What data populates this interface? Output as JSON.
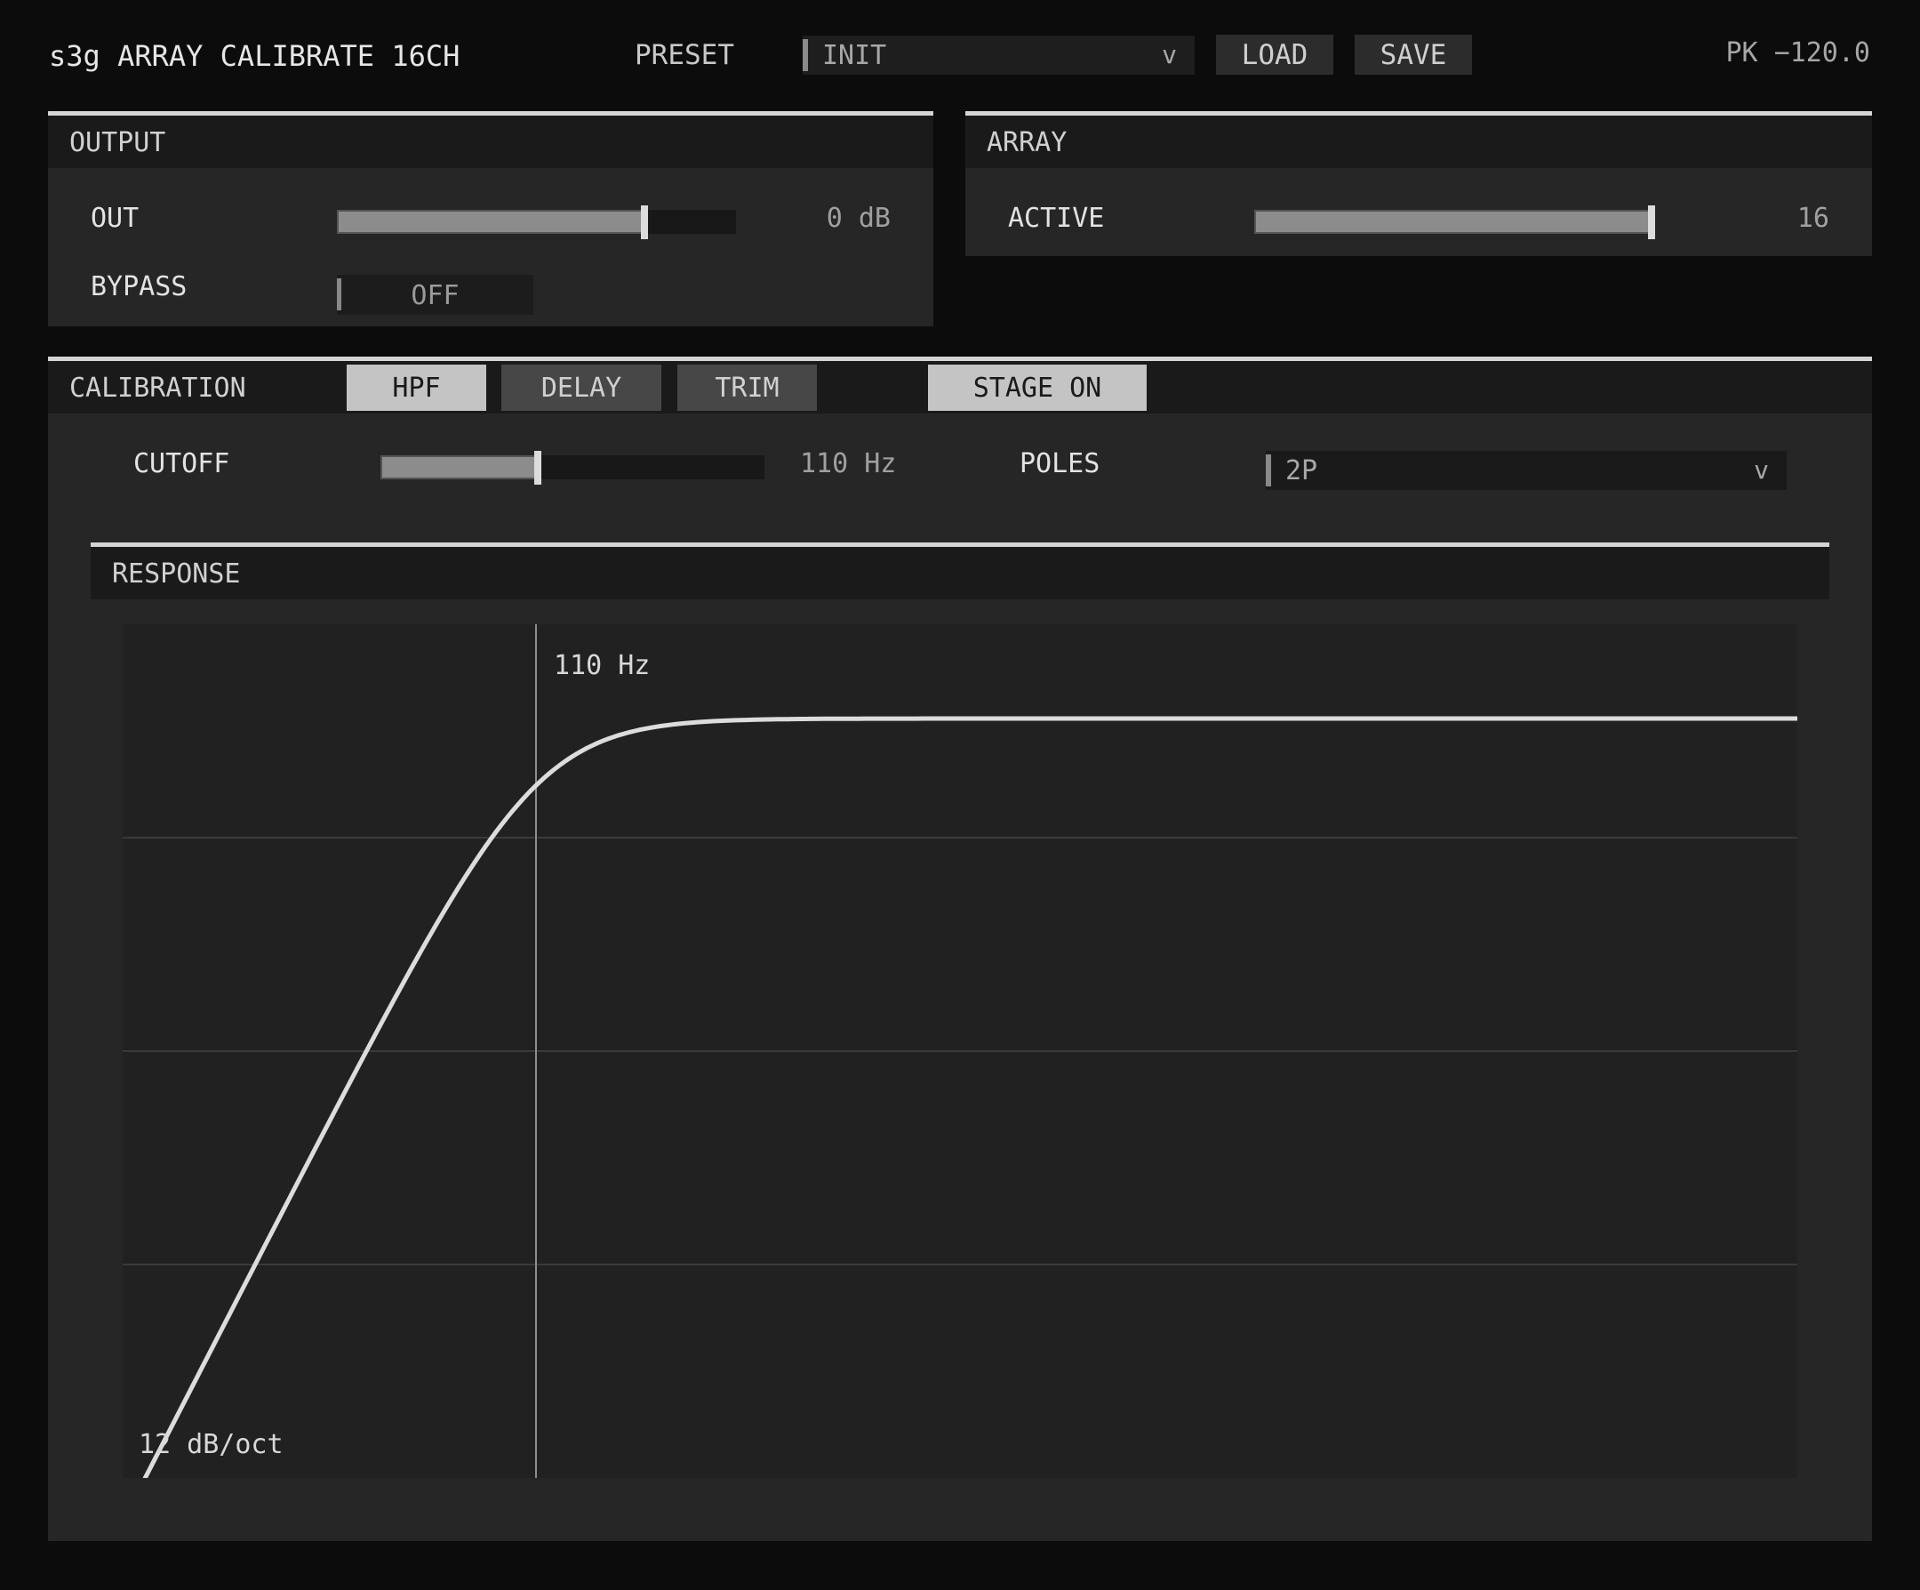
{
  "header": {
    "title": "s3g ARRAY CALIBRATE 16CH",
    "preset_label": "PRESET",
    "preset_value": "INIT",
    "preset_chevron": "v",
    "load_label": "LOAD",
    "save_label": "SAVE",
    "peak": "PK −120.0"
  },
  "output": {
    "title": "OUTPUT",
    "out_label": "OUT",
    "out_level": 0.77,
    "out_value": "0 dB",
    "bypass_label": "BYPASS",
    "bypass_value": "OFF"
  },
  "array": {
    "title": "ARRAY",
    "active_label": "ACTIVE",
    "active_level": 1.0,
    "active_value": "16"
  },
  "calibration": {
    "title": "CALIBRATION",
    "tabs": [
      {
        "label": "HPF",
        "active": true
      },
      {
        "label": "DELAY",
        "active": false
      },
      {
        "label": "TRIM",
        "active": false
      }
    ],
    "stage_label": "STAGE ON",
    "cutoff_label": "CUTOFF",
    "cutoff_level": 0.41,
    "cutoff_value": "110 Hz",
    "poles_label": "POLES",
    "poles_value": "2P",
    "poles_chevron": "v"
  },
  "response": {
    "title": "RESPONSE",
    "cutoff_marker_label": "110 Hz",
    "slope_label": "12 dB/oct"
  },
  "colors": {
    "background": "#0c0c0c",
    "panel": "#262626",
    "panel_header": "#1a1a1a",
    "accent_line": "#d4d4d4",
    "curve": "#dcdcdc"
  },
  "icons": {
    "dropdown": "chevron-down-icon"
  }
}
